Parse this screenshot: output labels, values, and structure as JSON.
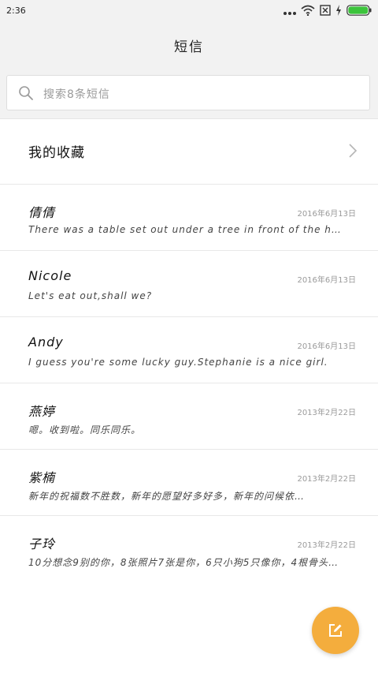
{
  "status_bar": {
    "time": "2:36"
  },
  "header": {
    "title": "短信"
  },
  "search": {
    "placeholder": "搜索8条短信"
  },
  "favorites": {
    "label": "我的收藏"
  },
  "messages": [
    {
      "name": "倩倩",
      "date": "2016年6月13日",
      "preview": "There was a table set out under a tree in front of the h…"
    },
    {
      "name": "Nicole",
      "date": "2016年6月13日",
      "preview": "Let's eat out,shall we?"
    },
    {
      "name": "Andy",
      "date": "2016年6月13日",
      "preview": "I guess you're some lucky guy.Stephanie is a nice girl."
    },
    {
      "name": "燕婷",
      "date": "2013年2月22日",
      "preview": "嗯。收到啦。同乐同乐。"
    },
    {
      "name": "紫楠",
      "date": "2013年2月22日",
      "preview": "新年的祝福数不胜数，新年的愿望好多好多，新年的问候依…"
    },
    {
      "name": "子玲",
      "date": "2013年2月22日",
      "preview": "10分想念9别的你，8张照片7张是你，6只小狗5只像你，4根骨头…"
    }
  ],
  "colors": {
    "fab": "#f4ad3d",
    "battery": "#3cc43c"
  }
}
